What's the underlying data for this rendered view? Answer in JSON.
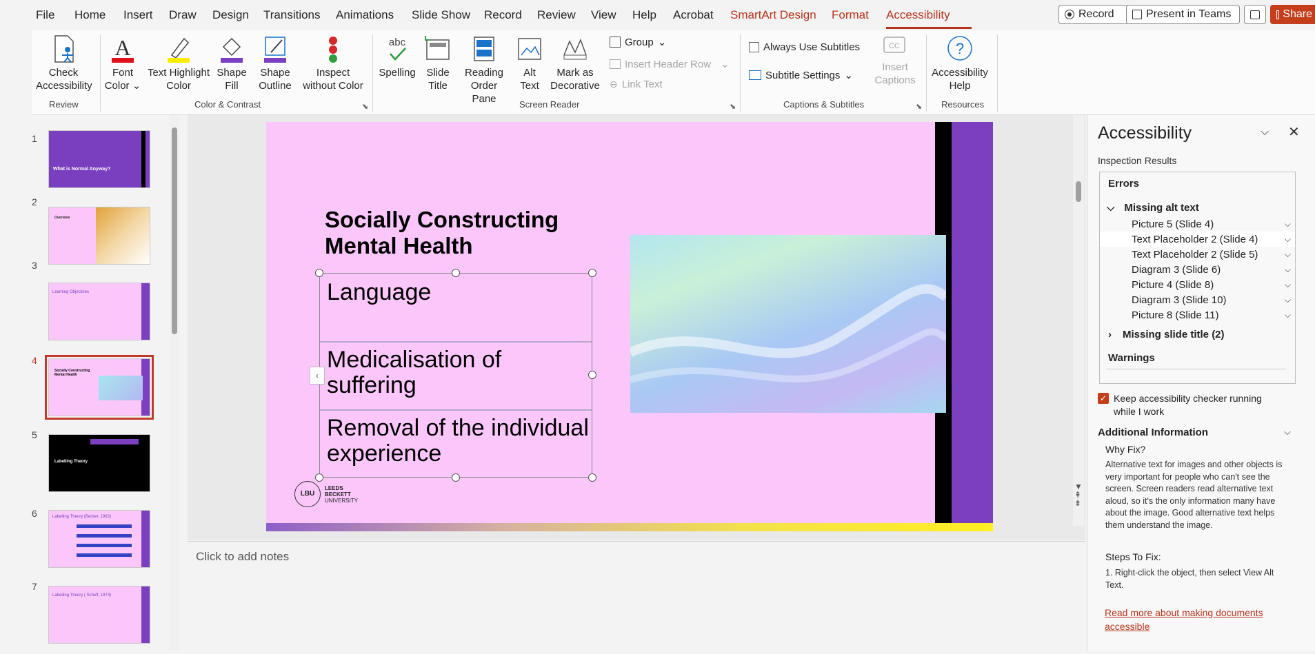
{
  "menu": {
    "items": [
      "File",
      "Home",
      "Insert",
      "Draw",
      "Design",
      "Transitions",
      "Animations",
      "Slide Show",
      "Record",
      "Review",
      "View",
      "Help",
      "Acrobat"
    ],
    "context_items": [
      "SmartArt Design",
      "Format"
    ],
    "active_item": "Accessibility",
    "record_btn": "Record",
    "present_btn": "Present in Teams",
    "share_btn": "Share"
  },
  "ribbon": {
    "review": {
      "check": "Check Accessibility",
      "label": "Review"
    },
    "color": {
      "font_color": "Font Color",
      "text_highlight": "Text Highlight Color",
      "shape_fill": "Shape Fill",
      "shape_outline": "Shape Outline",
      "inspect": "Inspect without Color",
      "label": "Color & Contrast"
    },
    "reader": {
      "spelling": "Spelling",
      "slide_title": "Slide Title",
      "reading_order": "Reading Order Pane",
      "alt_text": "Alt Text",
      "mark_decorative": "Mark as Decorative",
      "group": "Group",
      "insert_header_row": "Insert Header Row",
      "link_text": "Link Text",
      "label": "Screen Reader"
    },
    "captions": {
      "always_subtitles": "Always Use Subtitles",
      "subtitle_settings": "Subtitle Settings",
      "insert_captions": "Insert Captions",
      "label": "Captions & Subtitles"
    },
    "resources": {
      "help": "Accessibility Help",
      "label": "Resources"
    }
  },
  "thumbnails": {
    "numbers": [
      "1",
      "2",
      "3",
      "4",
      "5",
      "6",
      "7"
    ],
    "titles": [
      "What is Normal Anyway?",
      "Overview",
      "Learning Objectives",
      "Socially Constructing Mental Health",
      "Labelling Theory",
      "Labelling Theory (Becker, 1963)",
      "Labelling Theory ( Scheff, 1974)"
    ]
  },
  "slide": {
    "title": "Socially Constructing Mental Health",
    "bullets": [
      "Language",
      "Medicalisation of suffering",
      "Removal of the individual experience"
    ],
    "logo_text_1": "LEEDS",
    "logo_text_2": "BECKETT",
    "logo_text_3": "UNIVERSITY",
    "logo_mark": "LBU"
  },
  "notes": {
    "placeholder": "Click to add notes"
  },
  "accessibility": {
    "title": "Accessibility",
    "inspection": "Inspection Results",
    "errors": "Errors",
    "missing_alt": "Missing alt text",
    "alt_items": [
      "Picture 5  (Slide 4)",
      "Text Placeholder 2  (Slide 4)",
      "Text Placeholder 2  (Slide 5)",
      "Diagram 3  (Slide 6)",
      "Picture 4  (Slide 8)",
      "Diagram 3  (Slide 10)",
      "Picture 8  (Slide 11)"
    ],
    "missing_title": "Missing slide title (2)",
    "warnings": "Warnings",
    "keep_running": "Keep accessibility checker running while I work",
    "additional": "Additional Information",
    "why_fix": "Why Fix?",
    "why_text": "Alternative text for images and other objects is very important for people who can't see the screen. Screen readers read alternative text aloud, so it's the only information many have about the image. Good alternative text helps them understand the image.",
    "steps": "Steps To Fix:",
    "step1": "1. Right-click the object, then select View Alt Text.",
    "read_more": "Read more about making documents accessible"
  },
  "colors": {
    "accent": "#b5341c",
    "slide_bg": "#fbc7fb",
    "purple": "#7b3fbf"
  }
}
